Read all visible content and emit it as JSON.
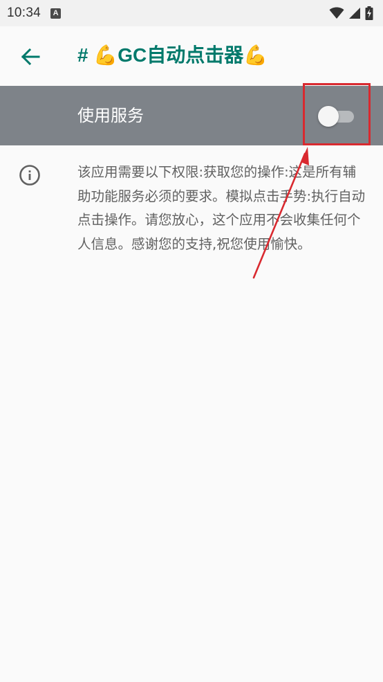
{
  "status_bar": {
    "time": "10:34",
    "notification_icon": "a-icon",
    "icons": [
      "wifi-icon",
      "signal-icon",
      "battery-charging-icon"
    ]
  },
  "app_bar": {
    "back_icon": "arrow-back-icon",
    "title": "# 💪GC自动点击器💪"
  },
  "service_switch": {
    "label": "使用服务",
    "checked": false
  },
  "description": {
    "icon": "info-icon",
    "text": "该应用需要以下权限:获取您的操作:这是所有辅助功能服务必须的要求。模拟点击手势:执行自动点击操作。请您放心，这个应用不会收集任何个人信息。感谢您的支持,祝您使用愉快。"
  },
  "colors": {
    "accent": "#00796b",
    "switch_bar": "#7e8389",
    "annotation": "#d9292f",
    "text_secondary": "#616161"
  }
}
